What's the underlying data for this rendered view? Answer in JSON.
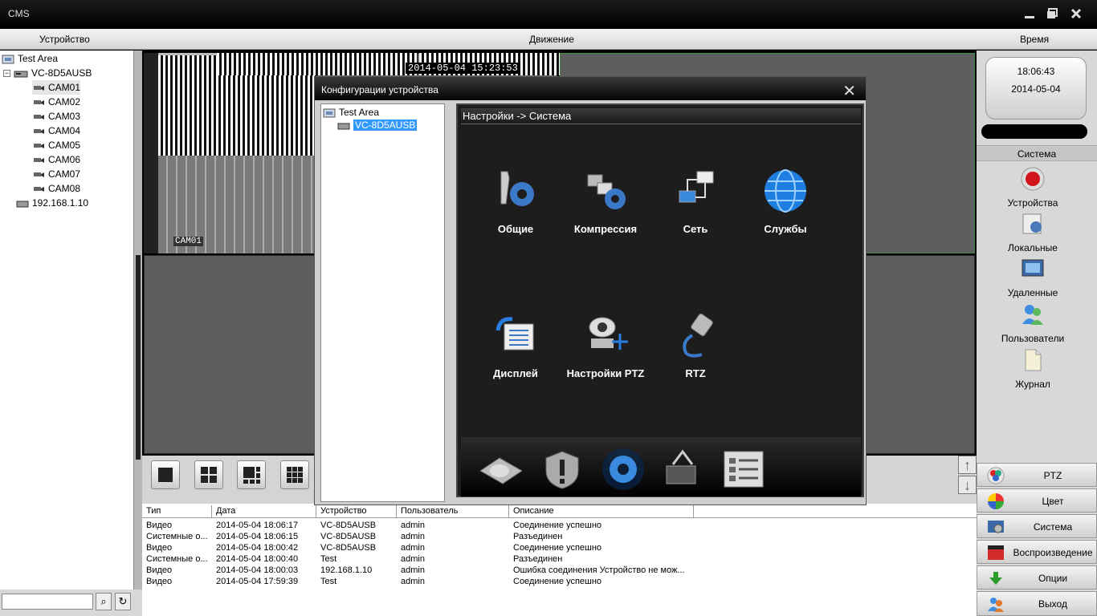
{
  "titlebar": {
    "title": "CMS"
  },
  "menubar": {
    "device": "Устройство",
    "motion": "Движение",
    "time": "Время"
  },
  "tree": {
    "root": "Test Area",
    "device": "VC-8D5AUSB",
    "cams": [
      "CAM01",
      "CAM02",
      "CAM03",
      "CAM04",
      "CAM05",
      "CAM06",
      "CAM07",
      "CAM08"
    ],
    "ip": "192.168.1.10"
  },
  "video": {
    "cam_label": "CAM01",
    "timestamp": "2014-05-04 15:23:53"
  },
  "clock": {
    "time": "18:06:43",
    "date": "2014-05-04"
  },
  "right_panel": {
    "header": "Система",
    "items": [
      {
        "label": "Устройства",
        "icon": "record-icon"
      },
      {
        "label": "Локальные",
        "icon": "local-config-icon"
      },
      {
        "label": "Удаленные",
        "icon": "remote-config-icon"
      },
      {
        "label": "Пользователи",
        "icon": "users-icon"
      },
      {
        "label": "Журнал",
        "icon": "log-icon"
      }
    ],
    "buttons": [
      {
        "label": "PTZ",
        "icon": "ptz-icon"
      },
      {
        "label": "Цвет",
        "icon": "color-icon"
      },
      {
        "label": "Система",
        "icon": "system-icon"
      },
      {
        "label": "Воспроизведение",
        "icon": "playback-icon"
      },
      {
        "label": "Опции",
        "icon": "options-icon"
      },
      {
        "label": "Выход",
        "icon": "exit-icon"
      }
    ]
  },
  "dialog": {
    "title": "Конфигурации устройства",
    "tree_root": "Test Area",
    "tree_device": "VC-8D5AUSB",
    "breadcrumb": "Настройки -> Система",
    "items": [
      {
        "label": "Общие",
        "icon": "general-settings-icon"
      },
      {
        "label": "Компрессия",
        "icon": "compression-icon"
      },
      {
        "label": "Сеть",
        "icon": "network-icon"
      },
      {
        "label": "Службы",
        "icon": "services-globe-icon"
      },
      {
        "label": "Дисплей",
        "icon": "display-icon"
      },
      {
        "label": "Настройки PTZ",
        "icon": "ptz-camera-icon"
      },
      {
        "label": "RTZ",
        "icon": "rs232-cable-icon"
      }
    ]
  },
  "log": {
    "headers": [
      "Тип",
      "Дата",
      "Устройство",
      "Пользователь",
      "Описание"
    ],
    "rows": [
      [
        "Видео",
        "2014-05-04 18:06:17",
        "VC-8D5AUSB",
        "admin",
        "Соединение успешно"
      ],
      [
        "Системные о...",
        "2014-05-04 18:06:15",
        "VC-8D5AUSB",
        "admin",
        "Разъединен"
      ],
      [
        "Видео",
        "2014-05-04 18:00:42",
        "VC-8D5AUSB",
        "admin",
        "Соединение успешно"
      ],
      [
        "Системные о...",
        "2014-05-04 18:00:40",
        "Test",
        "admin",
        "Разъединен"
      ],
      [
        "Видео",
        "2014-05-04 18:00:03",
        "192.168.1.10",
        "admin",
        "Ошибка соединения Устройство не мож..."
      ],
      [
        "Видео",
        "2014-05-04 17:59:39",
        "Test",
        "admin",
        "Соединение успешно"
      ]
    ]
  }
}
